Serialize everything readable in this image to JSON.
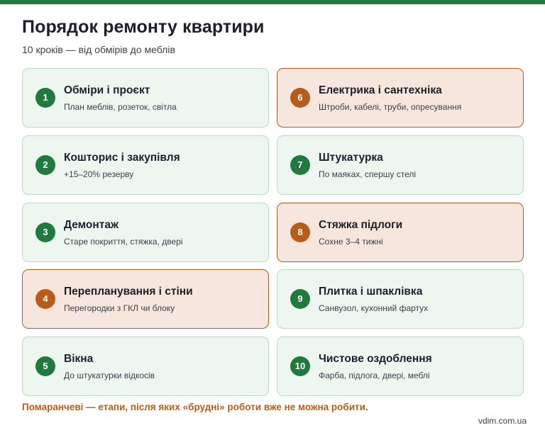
{
  "colors": {
    "accent_green": "#1f7a3e",
    "accent_orange": "#b85c1c",
    "card_green_bg": "#eef6f0",
    "card_orange_bg": "#f6e6dd"
  },
  "header": {
    "title": "Порядок ремонту квартири",
    "subtitle": "10 кроків — від обмірів до меблів"
  },
  "steps": [
    {
      "num": "1",
      "title": "Обміри і проєкт",
      "desc": "План меблів, розеток, світла",
      "highlight": false
    },
    {
      "num": "2",
      "title": "Кошторис і закупівля",
      "desc": "+15–20% резерву",
      "highlight": false
    },
    {
      "num": "3",
      "title": "Демонтаж",
      "desc": "Старе покриття, стяжка, двері",
      "highlight": false
    },
    {
      "num": "4",
      "title": "Перепланування і стіни",
      "desc": "Перегородки з ГКЛ чи блоку",
      "highlight": true
    },
    {
      "num": "5",
      "title": "Вікна",
      "desc": "До штукатурки відкосів",
      "highlight": false
    },
    {
      "num": "6",
      "title": "Електрика і сантехніка",
      "desc": "Штроби, кабелі, труби, опресування",
      "highlight": true
    },
    {
      "num": "7",
      "title": "Штукатурка",
      "desc": "По маяках, спершу стелі",
      "highlight": false
    },
    {
      "num": "8",
      "title": "Стяжка підлоги",
      "desc": "Сохне 3–4 тижні",
      "highlight": true
    },
    {
      "num": "9",
      "title": "Плитка і шпаклівка",
      "desc": "Санвузол, кухонний фартух",
      "highlight": false
    },
    {
      "num": "10",
      "title": "Чистове оздоблення",
      "desc": "Фарба, підлога, двері, меблі",
      "highlight": false
    }
  ],
  "footer": {
    "note": "Помаранчеві — етапи, після яких «брудні» роботи вже не можна робити.",
    "credit": "vdim.com.ua"
  }
}
